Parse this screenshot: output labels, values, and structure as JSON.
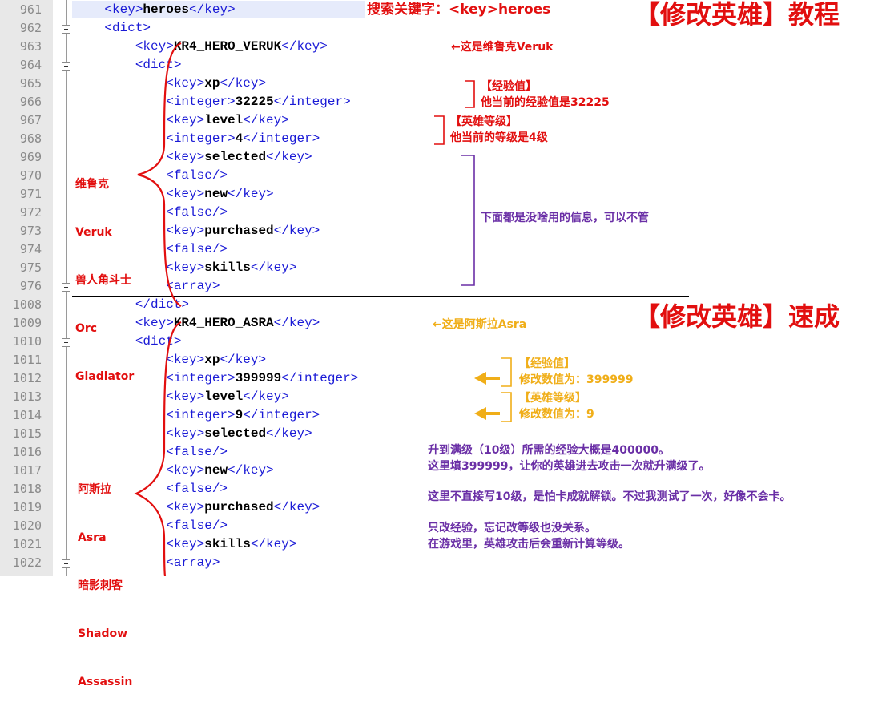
{
  "gutter": {
    "line_numbers": [
      "961",
      "962",
      "963",
      "964",
      "965",
      "966",
      "967",
      "968",
      "969",
      "970",
      "971",
      "972",
      "973",
      "974",
      "975",
      "976",
      "1008",
      "1009",
      "1010",
      "1011",
      "1012",
      "1013",
      "1014",
      "1015",
      "1016",
      "1017",
      "1018",
      "1019",
      "1020",
      "1021",
      "1022"
    ]
  },
  "code_lines": [
    {
      "indent": "    ",
      "open": "<key>",
      "text": "heroes",
      "close": "</key>"
    },
    {
      "indent": "    ",
      "open": "<dict>",
      "text": "",
      "close": ""
    },
    {
      "indent": "        ",
      "open": "<key>",
      "text": "KR4_HERO_VERUK",
      "close": "</key>"
    },
    {
      "indent": "        ",
      "open": "<dict>",
      "text": "",
      "close": ""
    },
    {
      "indent": "            ",
      "open": "<key>",
      "text": "xp",
      "close": "</key>"
    },
    {
      "indent": "            ",
      "open": "<integer>",
      "text": "32225",
      "close": "</integer>"
    },
    {
      "indent": "            ",
      "open": "<key>",
      "text": "level",
      "close": "</key>"
    },
    {
      "indent": "            ",
      "open": "<integer>",
      "text": "4",
      "close": "</integer>"
    },
    {
      "indent": "            ",
      "open": "<key>",
      "text": "selected",
      "close": "</key>"
    },
    {
      "indent": "            ",
      "open": "<false/>",
      "text": "",
      "close": ""
    },
    {
      "indent": "            ",
      "open": "<key>",
      "text": "new",
      "close": "</key>"
    },
    {
      "indent": "            ",
      "open": "<false/>",
      "text": "",
      "close": ""
    },
    {
      "indent": "            ",
      "open": "<key>",
      "text": "purchased",
      "close": "</key>"
    },
    {
      "indent": "            ",
      "open": "<false/>",
      "text": "",
      "close": ""
    },
    {
      "indent": "            ",
      "open": "<key>",
      "text": "skills",
      "close": "</key>"
    },
    {
      "indent": "            ",
      "open": "<array>",
      "text": "",
      "close": ""
    },
    {
      "indent": "        ",
      "open": "</dict>",
      "text": "",
      "close": ""
    },
    {
      "indent": "        ",
      "open": "<key>",
      "text": "KR4_HERO_ASRA",
      "close": "</key>"
    },
    {
      "indent": "        ",
      "open": "<dict>",
      "text": "",
      "close": ""
    },
    {
      "indent": "            ",
      "open": "<key>",
      "text": "xp",
      "close": "</key>"
    },
    {
      "indent": "            ",
      "open": "<integer>",
      "text": "399999",
      "close": "</integer>"
    },
    {
      "indent": "            ",
      "open": "<key>",
      "text": "level",
      "close": "</key>"
    },
    {
      "indent": "            ",
      "open": "<integer>",
      "text": "9",
      "close": "</integer>"
    },
    {
      "indent": "            ",
      "open": "<key>",
      "text": "selected",
      "close": "</key>"
    },
    {
      "indent": "            ",
      "open": "<false/>",
      "text": "",
      "close": ""
    },
    {
      "indent": "            ",
      "open": "<key>",
      "text": "new",
      "close": "</key>"
    },
    {
      "indent": "            ",
      "open": "<false/>",
      "text": "",
      "close": ""
    },
    {
      "indent": "            ",
      "open": "<key>",
      "text": "purchased",
      "close": "</key>"
    },
    {
      "indent": "            ",
      "open": "<false/>",
      "text": "",
      "close": ""
    },
    {
      "indent": "            ",
      "open": "<key>",
      "text": "skills",
      "close": "</key>"
    },
    {
      "indent": "            ",
      "open": "<array>",
      "text": "",
      "close": ""
    }
  ],
  "annotations": {
    "search_keyword": "搜索关键字：<key>heroes",
    "title_tutorial": "【修改英雄】教程",
    "title_quick": "【修改英雄】速成",
    "veruk_note": "←这是维鲁克Veruk",
    "veruk_label": [
      "维鲁克",
      "Veruk",
      "兽人角斗士",
      "Orc",
      "Gladiator"
    ],
    "xp_label": "【经验值】",
    "xp_current": "他当前的经验值是32225",
    "level_label": "【英雄等级】",
    "level_current": "他当前的等级是4级",
    "ignore_note": "下面都是没啥用的信息，可以不管",
    "asra_note": "←这是阿斯拉Asra",
    "asra_label": [
      "阿斯拉",
      "Asra",
      "暗影刺客",
      "Shadow",
      "Assassin"
    ],
    "xp_label_2": "【经验值】",
    "xp_modify": "修改数值为：399999",
    "level_label_2": "【英雄等级】",
    "level_modify": "修改数值为：9",
    "tip_1a": "升到满级（10级）所需的经验大概是400000。",
    "tip_1b": "这里填399999，让你的英雄进去攻击一次就升满级了。",
    "tip_2": "这里不直接写10级，是怕卡成就解锁。不过我测试了一次，好像不会卡。",
    "tip_3a": "只改经验，忘记改等级也没关系。",
    "tip_3b": "在游戏里，英雄攻击后会重新计算等级。"
  },
  "colors": {
    "red": "#e20f0f",
    "purple": "#6a2fa6",
    "gold": "#f0ae18",
    "tag": "#1a1ad6",
    "gutter": "#e8e8e8"
  }
}
